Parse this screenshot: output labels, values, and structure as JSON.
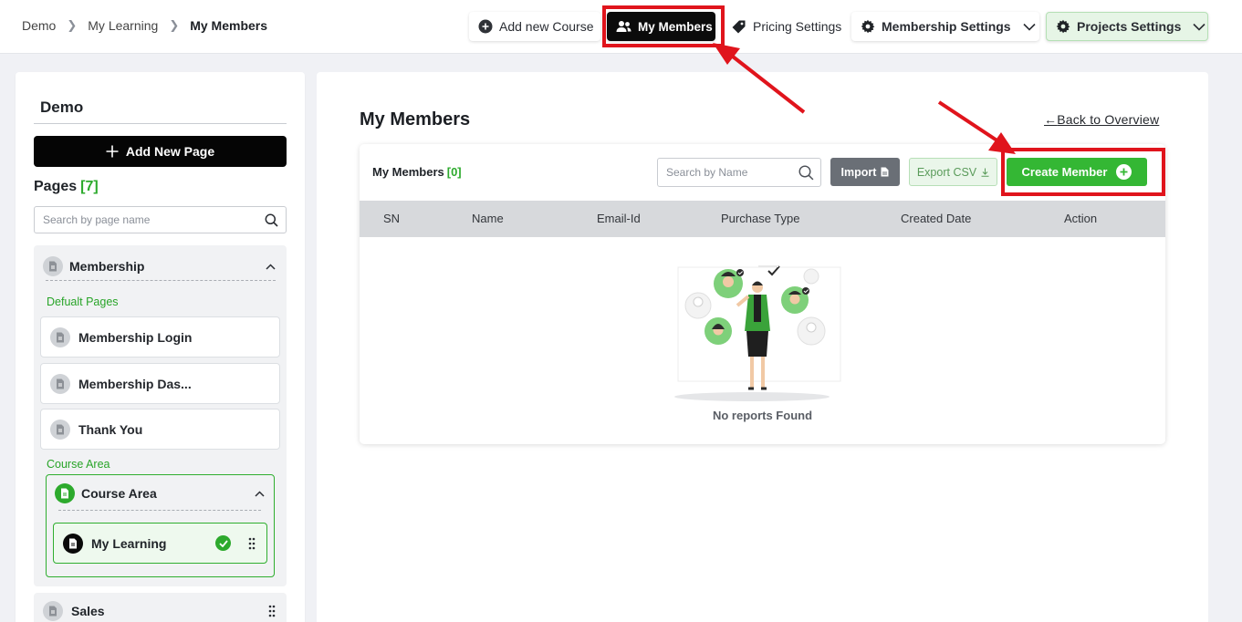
{
  "breadcrumb": [
    "Demo",
    "My Learning",
    "My Members"
  ],
  "topnav": {
    "add_course": "Add new Course",
    "my_members": "My Members",
    "pricing": "Pricing Settings",
    "membership_settings": "Membership Settings",
    "projects_settings": "Projects Settings"
  },
  "sidebar": {
    "title": "Demo",
    "add_page": "Add New Page",
    "pages_label": "Pages",
    "pages_count": "[7]",
    "search_placeholder": "Search by page name",
    "group": "Membership",
    "default_label": "Defualt Pages",
    "default_pages": [
      "Membership Login",
      "Membership Das...",
      "Thank You"
    ],
    "course_label": "Course Area",
    "course_group": "Course Area",
    "active_page": "My Learning",
    "sales": "Sales"
  },
  "main": {
    "title": "My Members",
    "back_link": "Back to Overview",
    "card_title": "My Members",
    "card_count": "[0]",
    "search_placeholder": "Search by Name",
    "import": "Import",
    "export": "Export CSV",
    "create": "Create Member",
    "columns": [
      "SN",
      "Name",
      "Email-Id",
      "Purchase Type",
      "Created Date",
      "Action"
    ],
    "empty_text": "No reports Found"
  },
  "colors": {
    "accent_green": "#34b734",
    "highlight_red": "#e0141c",
    "dark_button": "#0b0b0b"
  }
}
